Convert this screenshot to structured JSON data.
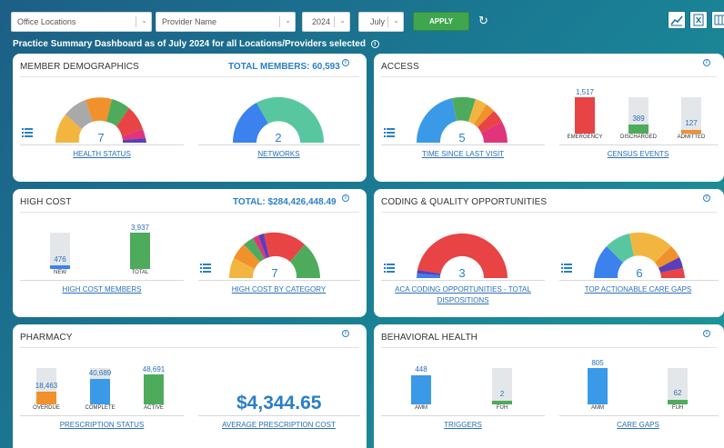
{
  "filters": {
    "office_locations": "Office Locations",
    "provider_name": "Provider Name",
    "year": "2024",
    "month": "July",
    "apply": "APPLY"
  },
  "subtitle": "Practice Summary Dashboard as of July 2024 for all Locations/Providers selected",
  "cards": {
    "member_demographics": {
      "title": "MEMBER DEMOGRAPHICS",
      "total": "TOTAL MEMBERS: 60,593",
      "health_status": {
        "number": "7",
        "link": "HEALTH STATUS"
      },
      "networks": {
        "number": "2",
        "link": "NETWORKS"
      }
    },
    "access": {
      "title": "ACCESS",
      "time_since_last_visit": {
        "number": "5",
        "link": "TIME SINCE LAST VISIT"
      },
      "census_events": {
        "link": "CENSUS EVENTS",
        "bars": [
          {
            "label": "EMERGENCY",
            "value": "1,517"
          },
          {
            "label": "DISCHARGED",
            "value": "389"
          },
          {
            "label": "ADMITTED",
            "value": "127"
          }
        ]
      }
    },
    "high_cost": {
      "title": "HIGH COST",
      "total": "TOTAL: $284,426,448.49",
      "members": {
        "link": "HIGH COST MEMBERS",
        "bars": [
          {
            "label": "NEW",
            "value": "476"
          },
          {
            "label": "TOTAL",
            "value": "3,937"
          }
        ]
      },
      "by_category": {
        "number": "7",
        "link": "HIGH COST BY CATEGORY"
      }
    },
    "coding_quality": {
      "title": "CODING & QUALITY OPPORTUNITIES",
      "aca": {
        "number": "3",
        "link1": "ACA CODING OPPORTUNITIES - TOTAL",
        "link2": "DISPOSITIONS"
      },
      "care_gaps": {
        "number": "6",
        "link": "TOP ACTIONABLE CARE GAPS"
      }
    },
    "pharmacy": {
      "title": "PHARMACY",
      "prescription_status": {
        "link": "PRESCRIPTION STATUS",
        "bars": [
          {
            "label": "OVERDUE",
            "value": "18,463"
          },
          {
            "label": "COMPLETE",
            "value": "40,689"
          },
          {
            "label": "ACTIVE",
            "value": "48,691"
          }
        ]
      },
      "avg_cost": {
        "amount": "$4,344.65",
        "link": "AVERAGE PRESCRIPTION COST"
      }
    },
    "behavioral_health": {
      "title": "BEHAVIORAL HEALTH",
      "triggers": {
        "link": "TRIGGERS",
        "bars": [
          {
            "label": "AMM",
            "value": "448"
          },
          {
            "label": "FUH",
            "value": "2"
          }
        ]
      },
      "care_gaps": {
        "link": "CARE GAPS",
        "bars": [
          {
            "label": "AMM",
            "value": "805"
          },
          {
            "label": "FUH",
            "value": "62"
          }
        ]
      }
    }
  }
}
